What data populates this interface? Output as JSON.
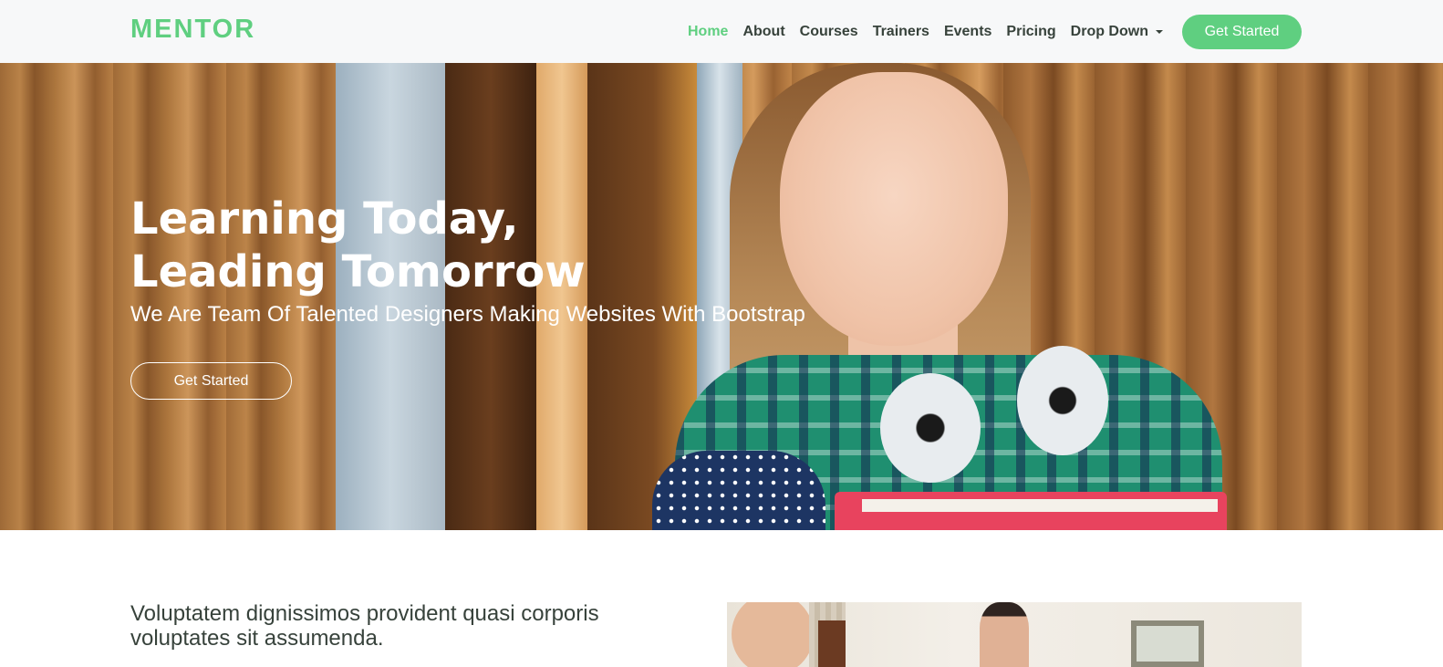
{
  "header": {
    "logo": "MENTOR",
    "nav": [
      {
        "label": "Home",
        "active": true
      },
      {
        "label": "About",
        "active": false
      },
      {
        "label": "Courses",
        "active": false
      },
      {
        "label": "Trainers",
        "active": false
      },
      {
        "label": "Events",
        "active": false
      },
      {
        "label": "Pricing",
        "active": false
      },
      {
        "label": "Drop Down",
        "active": false,
        "dropdown": true
      }
    ],
    "cta_label": "Get Started"
  },
  "hero": {
    "title_line1": "Learning Today,",
    "title_line2": "Leading Tomorrow",
    "subtitle": "We Are Team Of Talented Designers Making Websites With Bootstrap",
    "button_label": "Get Started"
  },
  "about": {
    "text": "Voluptatem dignissimos provident quasi corporis voluptates sit assumenda."
  },
  "colors": {
    "accent": "#5fcf80",
    "text": "#37423b",
    "header_bg": "#f7f8f9"
  },
  "icons": {
    "dropdown": "chevron-down-icon"
  }
}
